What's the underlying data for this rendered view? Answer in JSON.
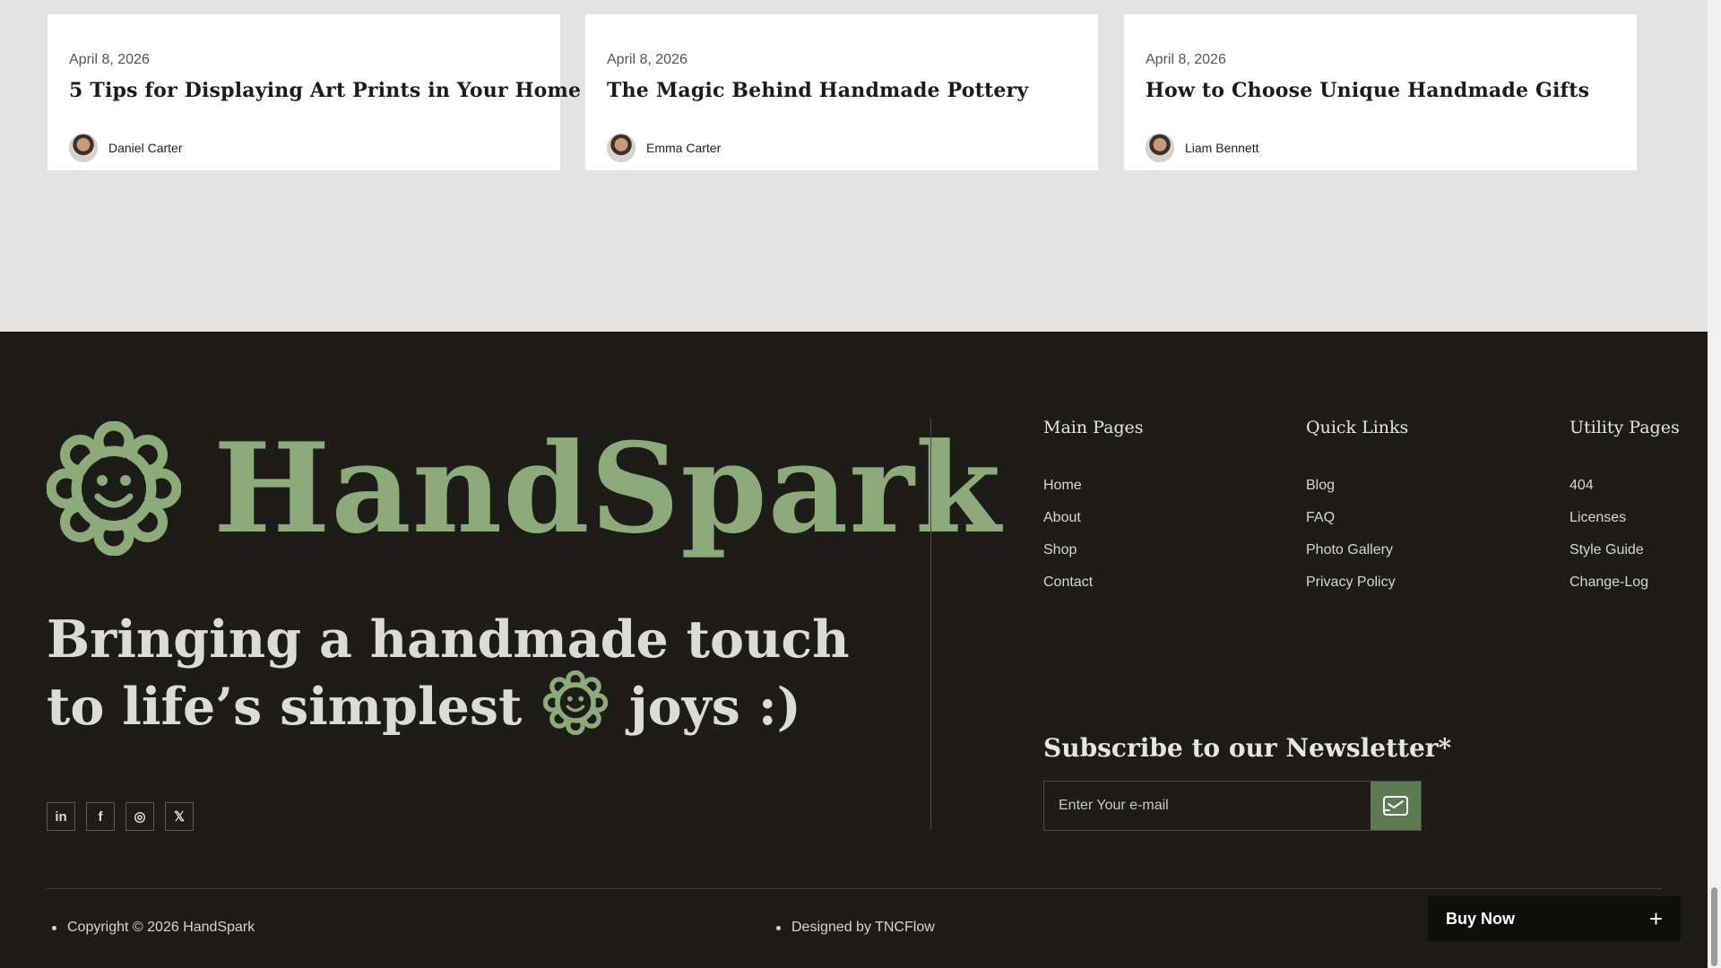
{
  "cards": [
    {
      "date": "April 8, 2026",
      "title": "5 Tips for Displaying Art Prints in Your Home",
      "author": "Daniel Carter"
    },
    {
      "date": "April 8, 2026",
      "title": "The Magic Behind Handmade Pottery",
      "author": "Emma Carter"
    },
    {
      "date": "April 8, 2026",
      "title": "How to Choose Unique Handmade Gifts",
      "author": "Liam Bennett"
    }
  ],
  "footer": {
    "logo_text": "HandSpark",
    "tagline_part1": "Bringing a handmade touch to life’s simplest",
    "tagline_part2": "joys :)",
    "socials": [
      {
        "icon": "linkedin-icon",
        "glyph": "in"
      },
      {
        "icon": "facebook-icon",
        "glyph": "f"
      },
      {
        "icon": "instagram-icon",
        "glyph": "◎"
      },
      {
        "icon": "x-twitter-icon",
        "glyph": "𝕏"
      }
    ],
    "columns": [
      {
        "heading": "Main Pages",
        "links": [
          "Home",
          "About",
          "Shop",
          "Contact"
        ]
      },
      {
        "heading": "Quick Links",
        "links": [
          "Blog",
          "FAQ",
          "Photo Gallery",
          "Privacy Policy"
        ]
      },
      {
        "heading": "Utility Pages",
        "links": [
          "404",
          "Licenses",
          "Style Guide",
          "Change-Log"
        ]
      }
    ],
    "newsletter": {
      "title": "Subscribe to our Newsletter*",
      "placeholder": "Enter Your e-mail"
    },
    "copyright": "Copyright © 2026 HandSpark",
    "designed_by": "Designed by TNCFlow"
  },
  "buy_now": {
    "label": "Buy Now",
    "icon": "plus-icon",
    "glyph": "+"
  },
  "colors": {
    "brand_green": "#8daa7a",
    "button_green": "#5b7b50",
    "footer_bg": "#1d1c18",
    "page_bg": "#e3e3e3"
  }
}
